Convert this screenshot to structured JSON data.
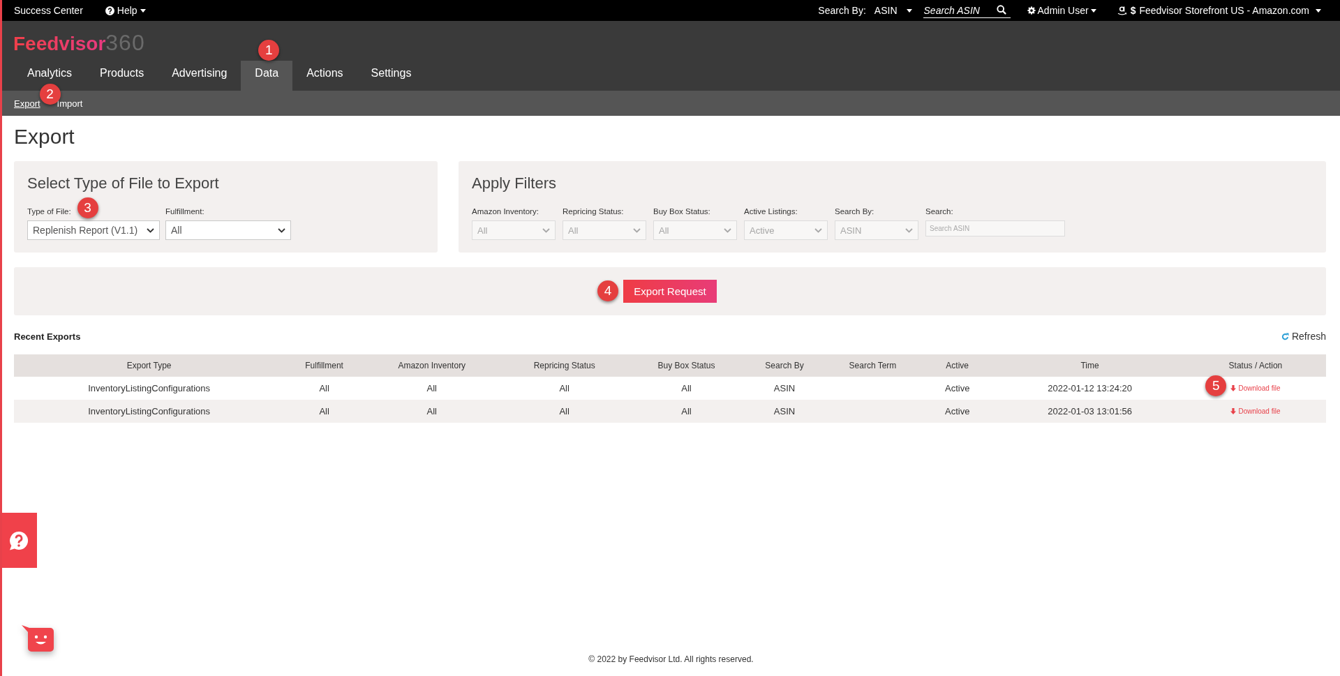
{
  "top_bar": {
    "success_center": "Success Center",
    "help": "Help",
    "search_by": {
      "label": "Search By:",
      "value": "ASIN"
    },
    "search": {
      "placeholder": "Search ASIN"
    },
    "user": "Admin User",
    "store": {
      "currency": "$",
      "name": "Feedvisor Storefront US - Amazon.com"
    }
  },
  "logo": {
    "brand": "Feedvisor",
    "suffix": "360"
  },
  "nav": [
    {
      "label": "Analytics",
      "selected": false
    },
    {
      "label": "Products",
      "selected": false
    },
    {
      "label": "Advertising",
      "selected": false
    },
    {
      "label": "Data",
      "selected": true,
      "callout": "1"
    },
    {
      "label": "Actions",
      "selected": false
    },
    {
      "label": "Settings",
      "selected": false
    }
  ],
  "subnav": [
    {
      "label": "Export",
      "selected": true,
      "callout": "2"
    },
    {
      "label": "Import",
      "selected": false
    }
  ],
  "page_title": "Export",
  "file_panel": {
    "title": "Select Type of File to Export",
    "fields": [
      {
        "kind": "select",
        "label": "Type of File:",
        "value": "Replenish Report (V1.1)",
        "disabled": false,
        "callout": "3"
      },
      {
        "kind": "select",
        "label": "Fulfillment:",
        "value": "All",
        "disabled": false
      }
    ]
  },
  "filter_panel": {
    "title": "Apply Filters",
    "fields": [
      {
        "kind": "select",
        "label": "Amazon Inventory:",
        "value": "All",
        "disabled": true
      },
      {
        "kind": "select",
        "label": "Repricing Status:",
        "value": "All",
        "disabled": true
      },
      {
        "kind": "select",
        "label": "Buy Box Status:",
        "value": "All",
        "disabled": true
      },
      {
        "kind": "select",
        "label": "Active Listings:",
        "value": "Active",
        "disabled": true
      },
      {
        "kind": "select",
        "label": "Search By:",
        "value": "ASIN",
        "disabled": true
      },
      {
        "kind": "text",
        "label": "Search:",
        "placeholder": "Search ASIN",
        "disabled": true
      }
    ]
  },
  "export_button": {
    "label": "Export Request",
    "callout": "4"
  },
  "recent_exports": {
    "title": "Recent Exports",
    "refresh": "Refresh",
    "columns": [
      "Export Type",
      "Fulfillment",
      "Amazon Inventory",
      "Repricing Status",
      "Buy Box Status",
      "Search By",
      "Search Term",
      "Active",
      "Time",
      "Status / Action"
    ],
    "rows": [
      {
        "cells": [
          "InventoryListingConfigurations",
          "All",
          "All",
          "All",
          "All",
          "ASIN",
          null,
          "Active",
          "2022-01-12 13:24:20"
        ],
        "action": "Download file",
        "callout": "5"
      },
      {
        "cells": [
          "InventoryListingConfigurations",
          "All",
          "All",
          "All",
          "All",
          "ASIN",
          null,
          "Active",
          "2022-01-03 13:01:56"
        ],
        "action": "Download file"
      }
    ]
  },
  "footer": "© 2022 by Feedvisor Ltd. All rights reserved."
}
